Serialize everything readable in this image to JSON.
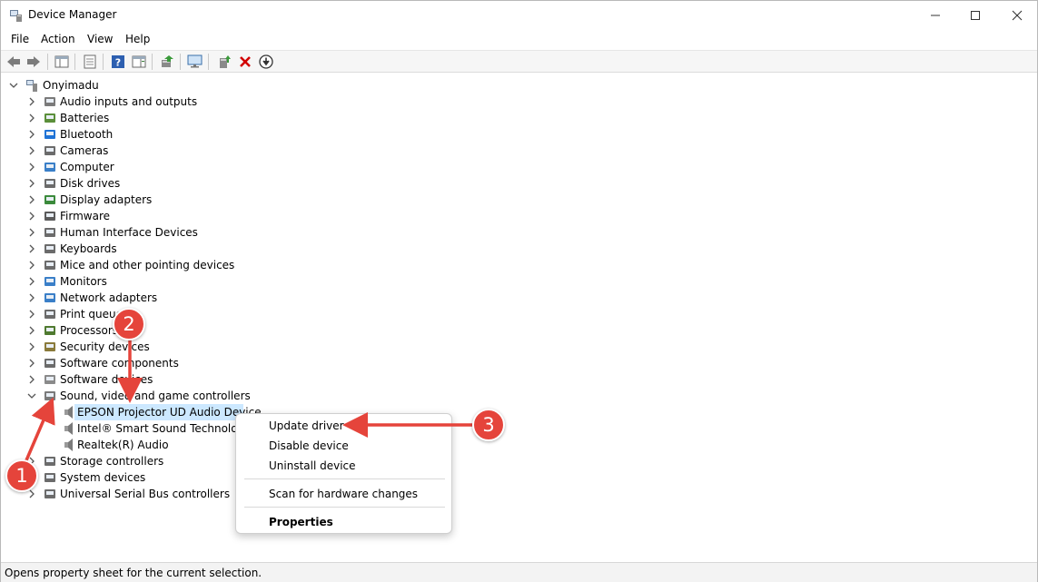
{
  "window": {
    "title": "Device Manager"
  },
  "menu": [
    "File",
    "Action",
    "View",
    "Help"
  ],
  "tree": {
    "root": "Onyimadu",
    "categories": [
      "Audio inputs and outputs",
      "Batteries",
      "Bluetooth",
      "Cameras",
      "Computer",
      "Disk drives",
      "Display adapters",
      "Firmware",
      "Human Interface Devices",
      "Keyboards",
      "Mice and other pointing devices",
      "Monitors",
      "Network adapters",
      "Print queues",
      "Processors",
      "Security devices",
      "Software components",
      "Software devices",
      "Sound, video and game controllers"
    ],
    "sound_children": [
      "EPSON Projector UD Audio Device",
      "Intel® Smart Sound Technology",
      "Realtek(R) Audio"
    ],
    "after": [
      "Storage controllers",
      "System devices",
      "Universal Serial Bus controllers"
    ]
  },
  "context_menu": {
    "update_driver": "Update driver",
    "disable_device": "Disable device",
    "uninstall_device": "Uninstall device",
    "scan": "Scan for hardware changes",
    "properties": "Properties"
  },
  "status": "Opens property sheet for the current selection.",
  "annotations": {
    "badge1": "1",
    "badge2": "2",
    "badge3": "3"
  },
  "colors": {
    "annotation": "#e5443b",
    "selection": "#cce8ff",
    "toolbar_remove": "#d20000"
  }
}
